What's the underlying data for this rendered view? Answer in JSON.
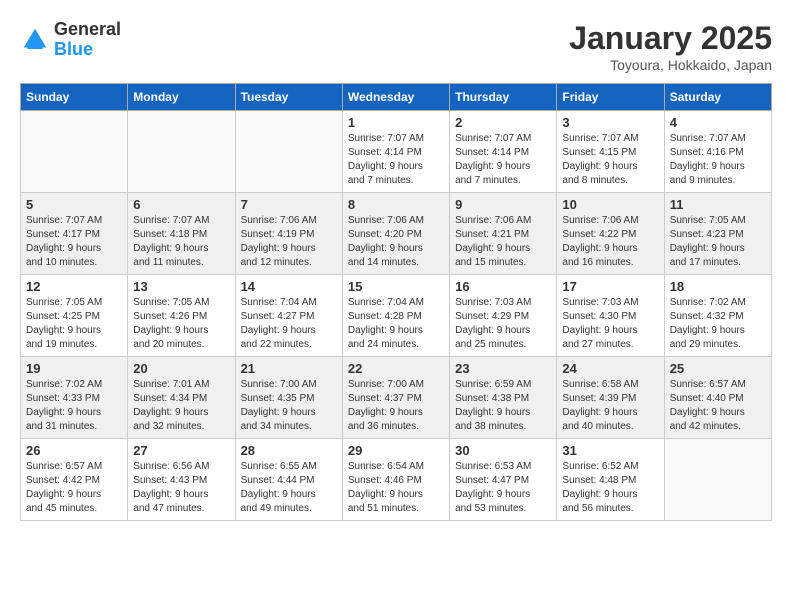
{
  "header": {
    "logo_general": "General",
    "logo_blue": "Blue",
    "month_title": "January 2025",
    "location": "Toyoura, Hokkaido, Japan"
  },
  "weekdays": [
    "Sunday",
    "Monday",
    "Tuesday",
    "Wednesday",
    "Thursday",
    "Friday",
    "Saturday"
  ],
  "weeks": [
    [
      {
        "day": "",
        "info": ""
      },
      {
        "day": "",
        "info": ""
      },
      {
        "day": "",
        "info": ""
      },
      {
        "day": "1",
        "info": "Sunrise: 7:07 AM\nSunset: 4:14 PM\nDaylight: 9 hours\nand 7 minutes."
      },
      {
        "day": "2",
        "info": "Sunrise: 7:07 AM\nSunset: 4:14 PM\nDaylight: 9 hours\nand 7 minutes."
      },
      {
        "day": "3",
        "info": "Sunrise: 7:07 AM\nSunset: 4:15 PM\nDaylight: 9 hours\nand 8 minutes."
      },
      {
        "day": "4",
        "info": "Sunrise: 7:07 AM\nSunset: 4:16 PM\nDaylight: 9 hours\nand 9 minutes."
      }
    ],
    [
      {
        "day": "5",
        "info": "Sunrise: 7:07 AM\nSunset: 4:17 PM\nDaylight: 9 hours\nand 10 minutes."
      },
      {
        "day": "6",
        "info": "Sunrise: 7:07 AM\nSunset: 4:18 PM\nDaylight: 9 hours\nand 11 minutes."
      },
      {
        "day": "7",
        "info": "Sunrise: 7:06 AM\nSunset: 4:19 PM\nDaylight: 9 hours\nand 12 minutes."
      },
      {
        "day": "8",
        "info": "Sunrise: 7:06 AM\nSunset: 4:20 PM\nDaylight: 9 hours\nand 14 minutes."
      },
      {
        "day": "9",
        "info": "Sunrise: 7:06 AM\nSunset: 4:21 PM\nDaylight: 9 hours\nand 15 minutes."
      },
      {
        "day": "10",
        "info": "Sunrise: 7:06 AM\nSunset: 4:22 PM\nDaylight: 9 hours\nand 16 minutes."
      },
      {
        "day": "11",
        "info": "Sunrise: 7:05 AM\nSunset: 4:23 PM\nDaylight: 9 hours\nand 17 minutes."
      }
    ],
    [
      {
        "day": "12",
        "info": "Sunrise: 7:05 AM\nSunset: 4:25 PM\nDaylight: 9 hours\nand 19 minutes."
      },
      {
        "day": "13",
        "info": "Sunrise: 7:05 AM\nSunset: 4:26 PM\nDaylight: 9 hours\nand 20 minutes."
      },
      {
        "day": "14",
        "info": "Sunrise: 7:04 AM\nSunset: 4:27 PM\nDaylight: 9 hours\nand 22 minutes."
      },
      {
        "day": "15",
        "info": "Sunrise: 7:04 AM\nSunset: 4:28 PM\nDaylight: 9 hours\nand 24 minutes."
      },
      {
        "day": "16",
        "info": "Sunrise: 7:03 AM\nSunset: 4:29 PM\nDaylight: 9 hours\nand 25 minutes."
      },
      {
        "day": "17",
        "info": "Sunrise: 7:03 AM\nSunset: 4:30 PM\nDaylight: 9 hours\nand 27 minutes."
      },
      {
        "day": "18",
        "info": "Sunrise: 7:02 AM\nSunset: 4:32 PM\nDaylight: 9 hours\nand 29 minutes."
      }
    ],
    [
      {
        "day": "19",
        "info": "Sunrise: 7:02 AM\nSunset: 4:33 PM\nDaylight: 9 hours\nand 31 minutes."
      },
      {
        "day": "20",
        "info": "Sunrise: 7:01 AM\nSunset: 4:34 PM\nDaylight: 9 hours\nand 32 minutes."
      },
      {
        "day": "21",
        "info": "Sunrise: 7:00 AM\nSunset: 4:35 PM\nDaylight: 9 hours\nand 34 minutes."
      },
      {
        "day": "22",
        "info": "Sunrise: 7:00 AM\nSunset: 4:37 PM\nDaylight: 9 hours\nand 36 minutes."
      },
      {
        "day": "23",
        "info": "Sunrise: 6:59 AM\nSunset: 4:38 PM\nDaylight: 9 hours\nand 38 minutes."
      },
      {
        "day": "24",
        "info": "Sunrise: 6:58 AM\nSunset: 4:39 PM\nDaylight: 9 hours\nand 40 minutes."
      },
      {
        "day": "25",
        "info": "Sunrise: 6:57 AM\nSunset: 4:40 PM\nDaylight: 9 hours\nand 42 minutes."
      }
    ],
    [
      {
        "day": "26",
        "info": "Sunrise: 6:57 AM\nSunset: 4:42 PM\nDaylight: 9 hours\nand 45 minutes."
      },
      {
        "day": "27",
        "info": "Sunrise: 6:56 AM\nSunset: 4:43 PM\nDaylight: 9 hours\nand 47 minutes."
      },
      {
        "day": "28",
        "info": "Sunrise: 6:55 AM\nSunset: 4:44 PM\nDaylight: 9 hours\nand 49 minutes."
      },
      {
        "day": "29",
        "info": "Sunrise: 6:54 AM\nSunset: 4:46 PM\nDaylight: 9 hours\nand 51 minutes."
      },
      {
        "day": "30",
        "info": "Sunrise: 6:53 AM\nSunset: 4:47 PM\nDaylight: 9 hours\nand 53 minutes."
      },
      {
        "day": "31",
        "info": "Sunrise: 6:52 AM\nSunset: 4:48 PM\nDaylight: 9 hours\nand 56 minutes."
      },
      {
        "day": "",
        "info": ""
      }
    ]
  ]
}
